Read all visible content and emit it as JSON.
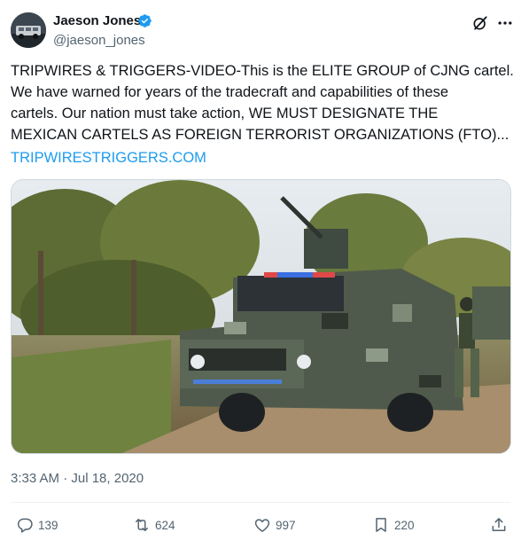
{
  "author": {
    "name": "Jaeson Jones",
    "handle": "@jaeson_jones",
    "verified": true
  },
  "tweet": {
    "lines": [
      "TRIPWIRES & TRIGGERS-VIDEO-This is the ELITE GROUP of CJNG cartel.",
      "We have warned for years of the tradecraft and capabilities of these",
      "cartels. Our nation must take action, WE MUST DESIGNATE THE",
      "MEXICAN CARTELS AS FOREIGN TERRORIST ORGANIZATIONS (FTO)..."
    ],
    "link": "TRIPWIRESTRIGGERS.COM",
    "timestamp": "3:33 AM · Jul 18, 2020"
  },
  "media": {
    "description_icon": "video-thumbnail"
  },
  "actions": {
    "replies": "139",
    "retweets": "624",
    "likes": "997",
    "bookmarks": "220"
  },
  "colors": {
    "accent": "#1d9bf0",
    "muted": "#536471",
    "text": "#0f1419"
  }
}
